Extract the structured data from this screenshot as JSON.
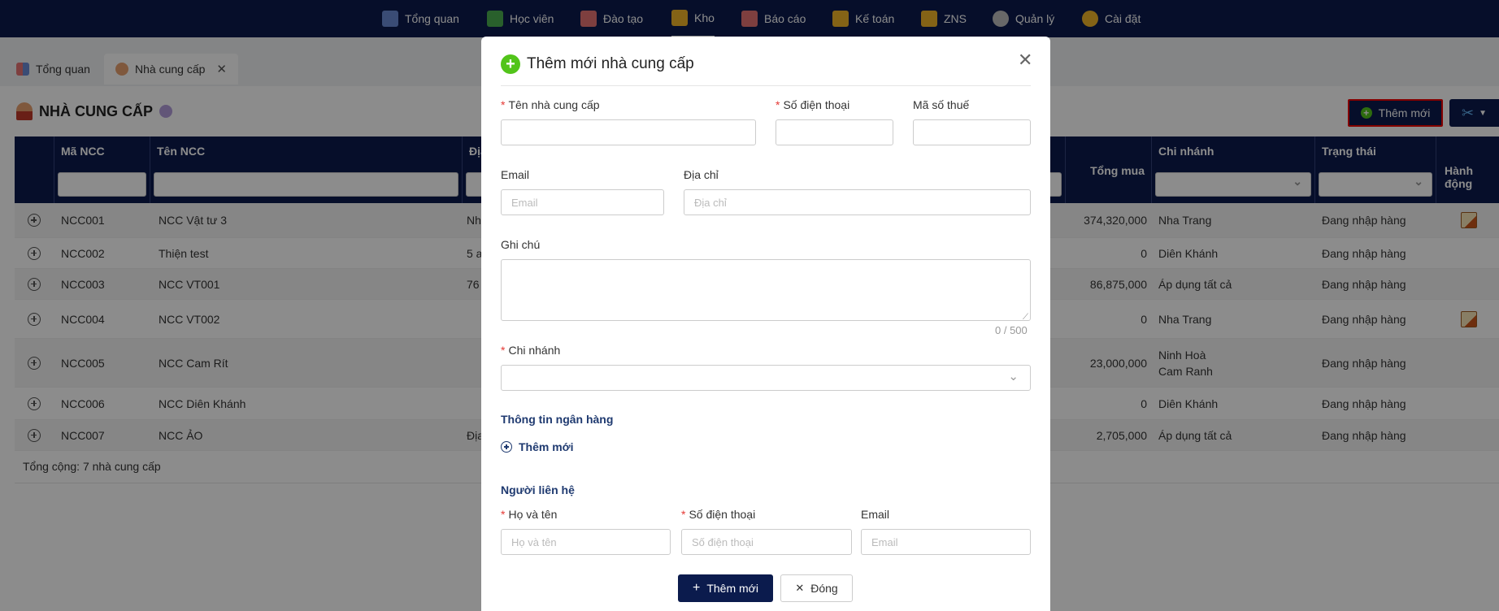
{
  "nav": {
    "items": [
      {
        "label": "Tổng quan",
        "icon": "dashboard-icon",
        "color": "#6b8bd6"
      },
      {
        "label": "Học viên",
        "icon": "graduation-cap-icon",
        "color": "#4caf50"
      },
      {
        "label": "Đào tạo",
        "icon": "teacher-icon",
        "color": "#e57373"
      },
      {
        "label": "Kho",
        "icon": "box-icon",
        "color": "#f0b429"
      },
      {
        "label": "Báo cáo",
        "icon": "chart-icon",
        "color": "#e57373"
      },
      {
        "label": "Kế toán",
        "icon": "coins-icon",
        "color": "#f0b429"
      },
      {
        "label": "ZNS",
        "icon": "mail-icon",
        "color": "#f0b429"
      },
      {
        "label": "Quản lý",
        "icon": "gears-icon",
        "color": "#bdbdbd"
      },
      {
        "label": "Cài đặt",
        "icon": "settings-icon",
        "color": "#f0b429"
      }
    ]
  },
  "tabs": [
    {
      "label": "Tổng quan"
    },
    {
      "label": "Nhà cung cấp"
    }
  ],
  "page": {
    "title": "NHÀ CUNG CẤP",
    "add_label": "Thêm mới",
    "total": "Tổng cộng: 7 nhà cung cấp"
  },
  "table": {
    "headers": {
      "code": "Mã NCC",
      "name": "Tên NCC",
      "address": "Địa",
      "total": "Tổng mua",
      "branch": "Chi nhánh",
      "status": "Trạng thái",
      "action": "Hành động"
    },
    "rows": [
      {
        "code": "NCC001",
        "name": "NCC Vật tư 3",
        "addr": "Nh",
        "total": "374,320,000",
        "branch": "Nha Trang",
        "branch2": "",
        "status": "Đang nhập hàng",
        "edit": true
      },
      {
        "code": "NCC002",
        "name": "Thiện test",
        "addr": "5 a",
        "total": "0",
        "branch": "Diên Khánh",
        "branch2": "",
        "status": "Đang nhập hàng",
        "edit": false
      },
      {
        "code": "NCC003",
        "name": "NCC VT001",
        "addr": "76",
        "total": "86,875,000",
        "branch": "Áp dụng tất cả",
        "branch2": "",
        "status": "Đang nhập hàng",
        "edit": false
      },
      {
        "code": "NCC004",
        "name": "NCC VT002",
        "addr": "",
        "total": "0",
        "branch": "Nha Trang",
        "branch2": "",
        "status": "Đang nhập hàng",
        "edit": true
      },
      {
        "code": "NCC005",
        "name": "NCC Cam Rít",
        "addr": "",
        "total": "23,000,000",
        "branch": "Ninh Hoà",
        "branch2": "Cam Ranh",
        "status": "Đang nhập hàng",
        "edit": false
      },
      {
        "code": "NCC006",
        "name": "NCC Diên Khánh",
        "addr": "",
        "total": "0",
        "branch": "Diên Khánh",
        "branch2": "",
        "status": "Đang nhập hàng",
        "edit": false
      },
      {
        "code": "NCC007",
        "name": "NCC ẢO",
        "addr": "Địa",
        "total": "2,705,000",
        "branch": "Áp dụng tất cả",
        "branch2": "",
        "status": "Đang nhập hàng",
        "edit": false
      }
    ]
  },
  "modal": {
    "title": "Thêm mới nhà cung cấp",
    "fields": {
      "supplier_name": {
        "label": "Tên nhà cung cấp",
        "placeholder": ""
      },
      "phone": {
        "label": "Số điện thoại",
        "placeholder": ""
      },
      "tax_code": {
        "label": "Mã số thuế",
        "placeholder": ""
      },
      "email": {
        "label": "Email",
        "placeholder": "Email"
      },
      "address": {
        "label": "Địa chỉ",
        "placeholder": "Địa chỉ"
      },
      "note": {
        "label": "Ghi chú",
        "counter": "0 / 500"
      },
      "branch": {
        "label": "Chi nhánh"
      }
    },
    "bank": {
      "title": "Thông tin ngân hàng",
      "add_label": "Thêm mới"
    },
    "contact": {
      "title": "Người liên hệ",
      "name": {
        "label": "Họ và tên",
        "placeholder": "Họ và tên"
      },
      "phone": {
        "label": "Số điện thoại",
        "placeholder": "Số điện thoại"
      },
      "email": {
        "label": "Email",
        "placeholder": "Email"
      }
    },
    "submit_label": "Thêm mới",
    "close_label": "Đóng"
  },
  "colors": {
    "primary": "#0b1b4d",
    "accent_green": "#52c41a",
    "required": "#e53935"
  }
}
